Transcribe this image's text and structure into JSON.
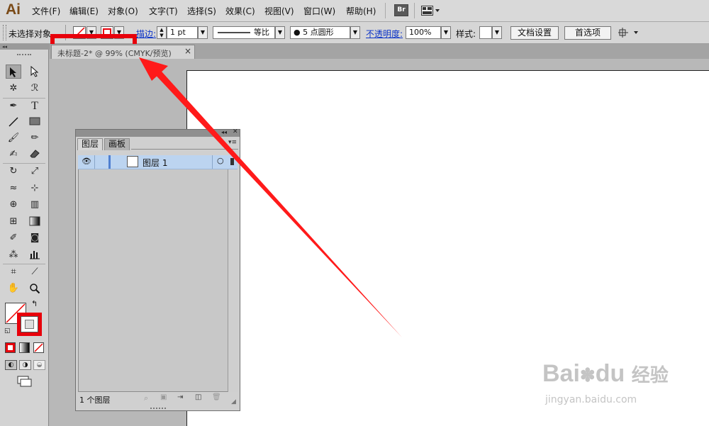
{
  "app": {
    "logo": "Ai"
  },
  "menu": {
    "items": [
      "文件(F)",
      "编辑(E)",
      "对象(O)",
      "文字(T)",
      "选择(S)",
      "效果(C)",
      "视图(V)",
      "窗口(W)",
      "帮助(H)"
    ],
    "bridge_label": "Br"
  },
  "control_bar": {
    "selection_status": "未选择对象",
    "stroke_label": "描边:",
    "stroke_weight": "1 pt",
    "stroke_profile": "等比",
    "brush": "5 点圆形",
    "opacity_label": "不透明度:",
    "opacity": "100%",
    "style_label": "样式:",
    "doc_setup": "文档设置",
    "preferences": "首选项"
  },
  "document": {
    "tab_title": "未标题-2* @ 99% (CMYK/预览)",
    "close_glyph": "×"
  },
  "layers_panel": {
    "tabs": [
      "图层",
      "画板"
    ],
    "layers": [
      {
        "name": "图层 1"
      }
    ],
    "footer_count": "1 个图层"
  },
  "colors": {
    "highlight": "#e8000b",
    "selection_row": "#bcd4f0",
    "arrow": "#ff1a1a"
  },
  "watermark": {
    "brand": "Bai",
    "brand2": "du",
    "sub": "经验",
    "url": "jingyan.baidu.com"
  }
}
